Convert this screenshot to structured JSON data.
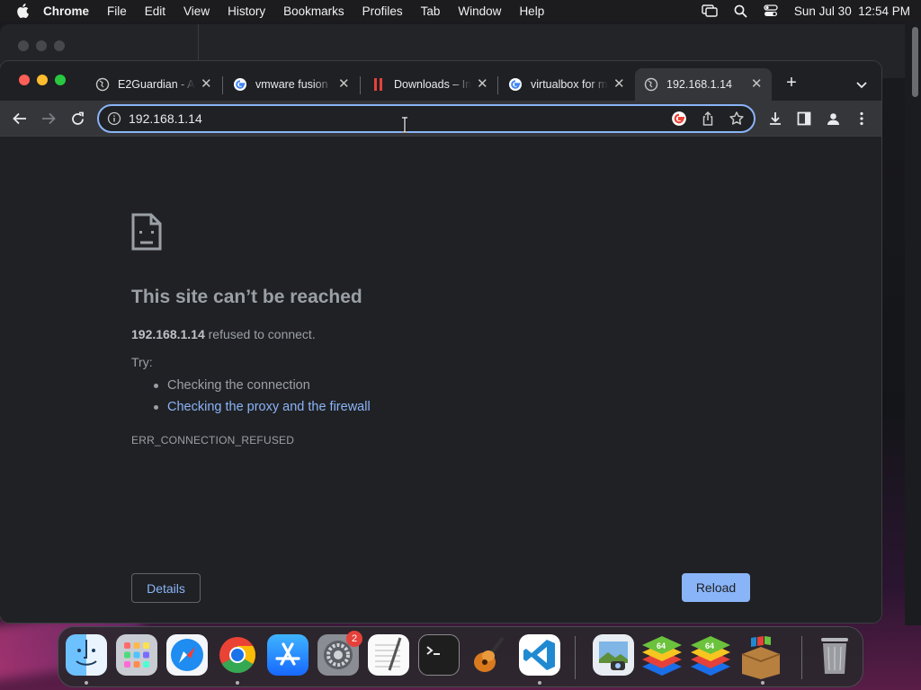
{
  "menubar": {
    "app_name": "Chrome",
    "items": [
      "File",
      "Edit",
      "View",
      "History",
      "Bookmarks",
      "Profiles",
      "Tab",
      "Window",
      "Help"
    ],
    "clock": "Sun Jul 30  12:54 PM"
  },
  "tabs": [
    {
      "title": "E2Guardian - Ac",
      "icon": "globe-icon",
      "active": false
    },
    {
      "title": "vmware fusion - ",
      "icon": "google-icon",
      "active": false
    },
    {
      "title": "Downloads – Int",
      "icon": "parallels-icon",
      "active": false
    },
    {
      "title": "virtualbox for m",
      "icon": "google-icon",
      "active": false
    },
    {
      "title": "192.168.1.14",
      "icon": "globe-icon",
      "active": true
    }
  ],
  "address_bar": {
    "url": "192.168.1.14"
  },
  "error_page": {
    "title": "This site can’t be reached",
    "host": "192.168.1.14",
    "message": " refused to connect.",
    "try_label": "Try:",
    "suggestions": [
      {
        "text": "Checking the connection",
        "link": false
      },
      {
        "text": "Checking the proxy and the firewall",
        "link": true
      }
    ],
    "error_code": "ERR_CONNECTION_REFUSED",
    "details_label": "Details",
    "reload_label": "Reload"
  },
  "dock": {
    "apps": [
      "Finder",
      "Launchpad",
      "Safari",
      "Google Chrome",
      "App Store",
      "System Settings",
      "TextEdit",
      "Terminal",
      "GarageBand",
      "Visual Studio Code",
      "Preview",
      "BlueStacks",
      "BlueStacks X",
      "Boot Camp Assistant",
      "Trash"
    ],
    "settings_badge": "2"
  },
  "colors": {
    "accent": "#8ab4f8",
    "page_bg": "#202124",
    "toolbar_bg": "#35363a"
  }
}
